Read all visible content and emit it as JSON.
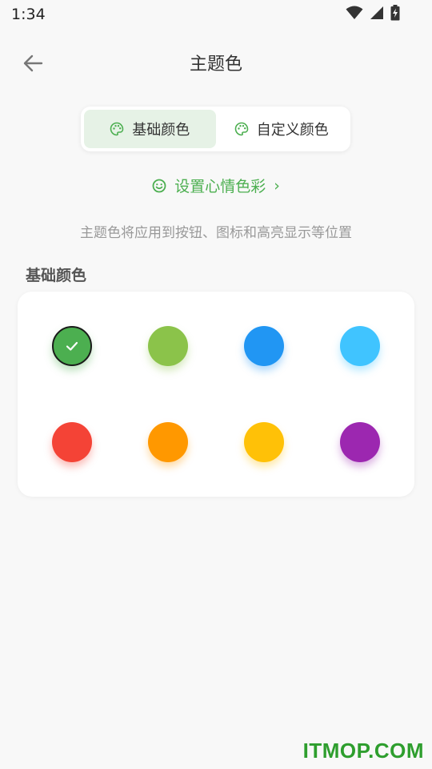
{
  "status_bar": {
    "time": "1:34"
  },
  "header": {
    "title": "主题色"
  },
  "segment": {
    "tabs": [
      {
        "label": "基础颜色",
        "active": true
      },
      {
        "label": "自定义颜色",
        "active": false
      }
    ]
  },
  "mood_link": {
    "label": "设置心情色彩",
    "chevron": "›"
  },
  "description": "主题色将应用到按钮、图标和高亮显示等位置",
  "basic_colors": {
    "title": "基础颜色",
    "swatches": [
      {
        "color": "#4caf50",
        "selected": true
      },
      {
        "color": "#8bc34a",
        "selected": false
      },
      {
        "color": "#2196f3",
        "selected": false
      },
      {
        "color": "#40c4ff",
        "selected": false
      },
      {
        "color": "#f44336",
        "selected": false
      },
      {
        "color": "#ff9800",
        "selected": false
      },
      {
        "color": "#ffc107",
        "selected": false
      },
      {
        "color": "#9c27b0",
        "selected": false
      }
    ]
  },
  "watermark": "ITMOP.COM",
  "colors": {
    "accent": "#4caf50",
    "active_tab_bg": "#e6f2e6"
  }
}
